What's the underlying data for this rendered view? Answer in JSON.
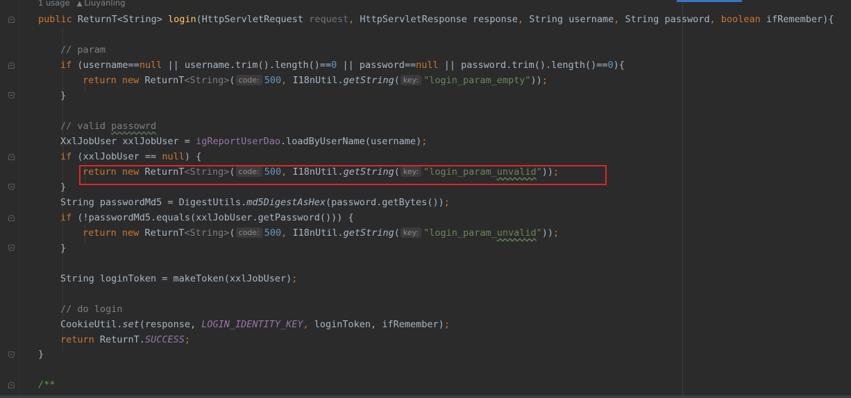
{
  "editor": {
    "usages": "1 usage",
    "author": "Liuyanling",
    "lines": {
      "signature": {
        "public": "public",
        "return_type": "ReturnT<String>",
        "name": "login",
        "p1_type": "HttpServletRequest",
        "p1_name": "request",
        "p2_type": "HttpServletResponse",
        "p2_name": "response",
        "p3_type": "String",
        "p3_name": "username",
        "p4_type": "String",
        "p4_name": "password",
        "p5_type": "boolean",
        "p5_name": "ifRemember",
        "open": "){"
      },
      "comment_param": "// param",
      "if_params": {
        "if": "if",
        "a": " (username==",
        "null1": "null",
        "b": " || username.trim().length()==",
        "zero1": "0",
        "c": " || password==",
        "null2": "null",
        "d": " || password.trim().length()==",
        "zero2": "0",
        "e": "){"
      },
      "ret_empty": {
        "return": "return",
        "new": "new",
        "cls": "ReturnT",
        "generic": "<String>",
        "code_hint": "code:",
        "code": "500",
        "util": "I18nUtil.",
        "method": "getString",
        "key_hint": "key:",
        "key": "\"login_param_empty\""
      },
      "brace_close": "}",
      "comment_valid": "// valid ",
      "comment_valid_word": "passowrd",
      "load_user": {
        "type": "XxlJobUser xxlJobUser = ",
        "dao": "igReportUserDao",
        "call": ".loadByUserName(username)"
      },
      "if_null": {
        "if": "if",
        "a": " (xxlJobUser == ",
        "null": "null",
        "b": ") {"
      },
      "ret_unvalid": {
        "key_prefix": "\"login_param_",
        "key_word": "unvalid",
        "key_suffix": "\""
      },
      "md5": {
        "a": "String passwordMd5 = DigestUtils.",
        "method": "md5DigestAsHex",
        "b": "(password.getBytes())"
      },
      "if_equals": {
        "if": "if",
        "a": " (!passwordMd5.equals(xxlJobUser.getPassword())) {"
      },
      "token": {
        "a": "String loginToken = makeToken(xxlJobUser)"
      },
      "comment_login": "// do login",
      "cookie": {
        "a": "CookieUtil.",
        "method": "set",
        "b": "(response, ",
        "const": "LOGIN_IDENTITY_KEY",
        "c": " loginToken, ifRemember)"
      },
      "ret_success": {
        "return": "return",
        "a": " ReturnT.",
        "field": "SUCCESS"
      },
      "doc_open": "/**"
    }
  }
}
